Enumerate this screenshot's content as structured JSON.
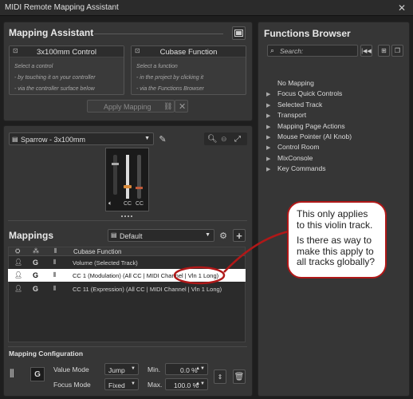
{
  "window": {
    "title": "MIDI Remote Mapping Assistant",
    "close": "✕"
  },
  "mapping_assistant": {
    "title": "Mapping Assistant",
    "controller_box": {
      "title": "3x100mm Control",
      "hints": [
        "Select a control",
        "- by touching it on your controller",
        "- via the controller surface below"
      ]
    },
    "function_box": {
      "title": "Cubase Function",
      "hints": [
        "Select a function",
        "- in the project by clicking it",
        "- via the Functions Browser"
      ]
    },
    "apply_label": "Apply Mapping"
  },
  "surface": {
    "device": "Sparrow - 3x100mm",
    "fader_labels": [
      "CC",
      "CC"
    ]
  },
  "mappings": {
    "title": "Mappings",
    "page": "Default",
    "header_function": "Cubase Function",
    "rows": [
      {
        "g": "G",
        "function": "Volume (Selected Track)",
        "selected": false
      },
      {
        "g": "G",
        "function": "CC 1  (Modulation) (All CC | MIDI Channel | Vln 1 Long)",
        "selected": true
      },
      {
        "g": "G",
        "function": "CC 11  (Expression) (All CC | MIDI Channel | Vln 1 Long)",
        "selected": false
      }
    ]
  },
  "config": {
    "title": "Mapping Configuration",
    "g": "G",
    "value_mode_label": "Value Mode",
    "value_mode": "Jump",
    "focus_mode_label": "Focus Mode",
    "focus_mode": "Fixed",
    "min_label": "Min.",
    "min_value": "0.0 %",
    "max_label": "Max.",
    "max_value": "100.0 %"
  },
  "functions_browser": {
    "title": "Functions Browser",
    "search_placeholder": "Search:",
    "items": [
      {
        "label": "No Mapping",
        "expandable": false
      },
      {
        "label": "Focus Quick Controls",
        "expandable": true
      },
      {
        "label": "Selected Track",
        "expandable": true
      },
      {
        "label": "Transport",
        "expandable": true
      },
      {
        "label": "Mapping Page Actions",
        "expandable": true
      },
      {
        "label": "Mouse Pointer (AI Knob)",
        "expandable": true
      },
      {
        "label": "Control Room",
        "expandable": true
      },
      {
        "label": "MixConsole",
        "expandable": true
      },
      {
        "label": "Key Commands",
        "expandable": true
      }
    ]
  },
  "annotation": {
    "line1": "This only applies to this violin track.",
    "line2": "Is there as way to make this apply to all tracks globally?"
  },
  "colors": {
    "annotation_border": "#b01818",
    "selected_row": "#ffffff",
    "fader_orange": "#d98a3a"
  }
}
